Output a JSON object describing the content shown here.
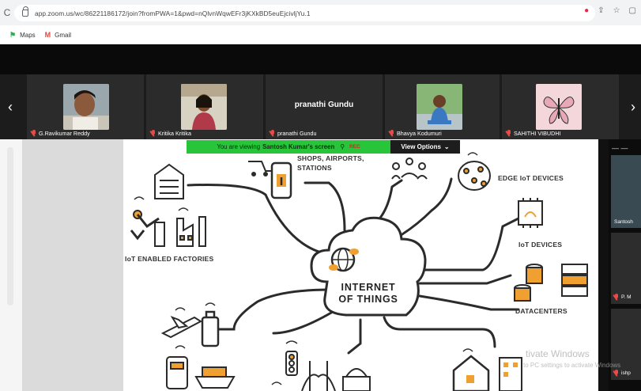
{
  "browser": {
    "url": "app.zoom.us/wc/86221186172/join?fromPWA=1&pwd=nQlvnWqwEFr3jKXkBD5euEjcivljYu.1",
    "bookmarks": [
      "Maps",
      "Gmail"
    ]
  },
  "participants": [
    {
      "name": "G.Ravikumar Reddy",
      "muted": true
    },
    {
      "name": "Kritika Kritika",
      "muted": true
    },
    {
      "name": "pranathi Gundu",
      "display_name": "pranathi Gundu",
      "muted": true
    },
    {
      "name": "Bhavya Kodumuri",
      "muted": true
    },
    {
      "name": "SAHITHI VIBUDHI",
      "muted": true
    }
  ],
  "banner": {
    "text_prefix": "You are viewing",
    "presenter": "Santosh Kumar's screen",
    "rec": "REC",
    "view_options": "View Options"
  },
  "slide": {
    "center_line1": "INTERNET",
    "center_line2": "OF THINGS",
    "labels": {
      "shops": "SHOPS, AIRPORTS,",
      "stations": "STATIONS",
      "edge": "EDGE IoT DEVICES",
      "iot_devices": "IoT DEVICES",
      "factories": "IoT ENABLED FACTORIES",
      "datacenters": "DATACENTERS"
    }
  },
  "gallery": [
    {
      "name": "Santosh"
    },
    {
      "name": "P. M"
    },
    {
      "name": "ishp"
    }
  ],
  "watermark": {
    "line1": "tivate Windows",
    "line2": "to PC settings to activate Windows"
  }
}
